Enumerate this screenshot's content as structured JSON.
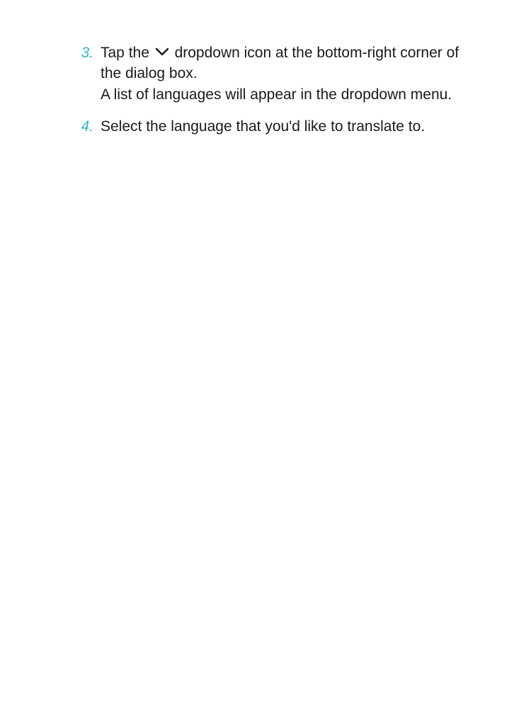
{
  "steps": [
    {
      "number": "3.",
      "text_before_icon": "Tap the ",
      "text_after_icon": " dropdown icon at the bottom-right corner of the dialog box.",
      "text_line2": "A list of languages will appear in the dropdown menu."
    },
    {
      "number": "4.",
      "text": "Select the language that you'd like to translate to."
    }
  ]
}
